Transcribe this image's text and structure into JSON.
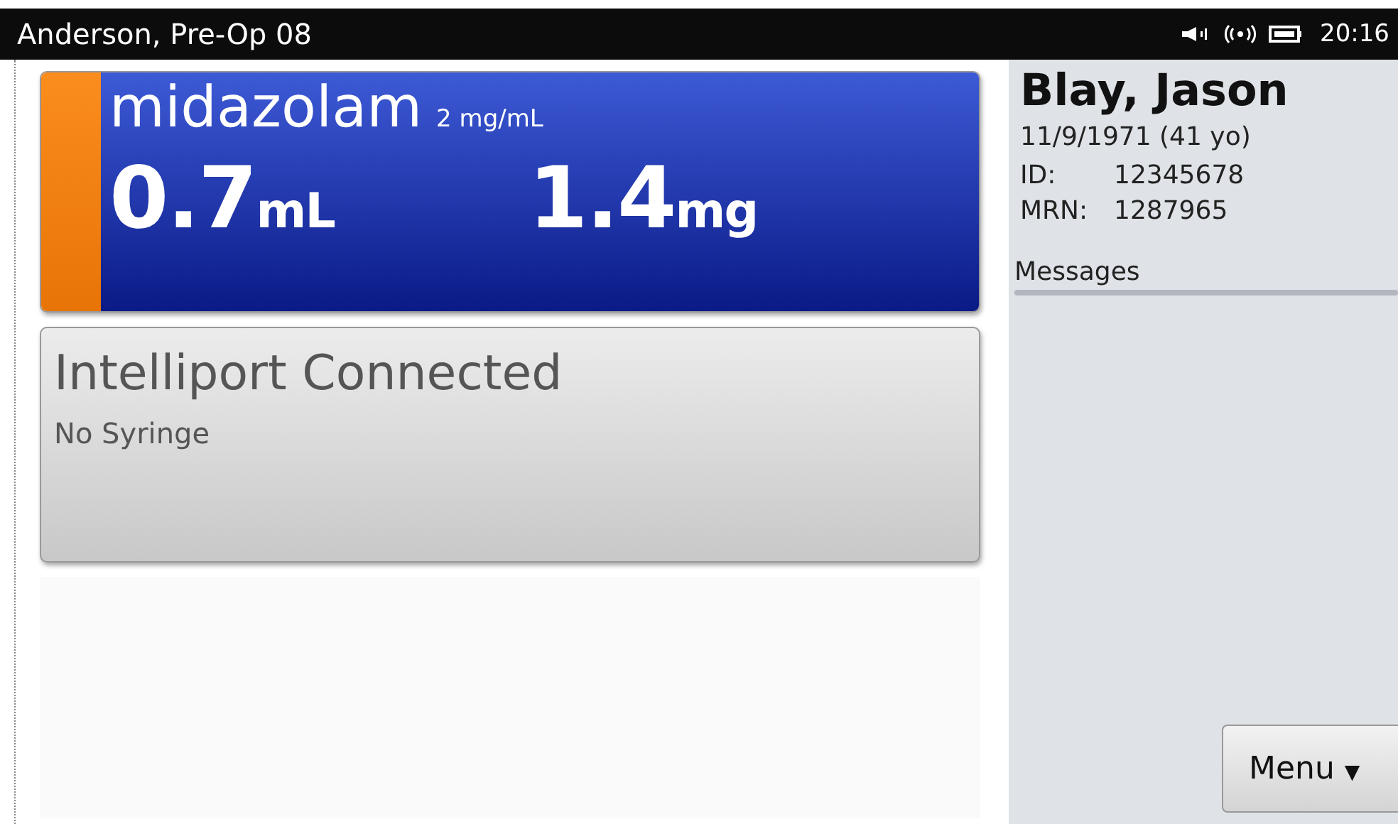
{
  "status_bar": {
    "title": "Anderson, Pre-Op 08",
    "time": "20:16"
  },
  "drug_card": {
    "name": "midazolam",
    "concentration": "2 mg/mL",
    "volume": "0.7",
    "volume_unit": "mL",
    "dose": "1.4",
    "dose_unit": "mg"
  },
  "port_card": {
    "title": "Intelliport Connected",
    "status": "No Syringe"
  },
  "patient": {
    "name": "Blay, Jason",
    "dob": "11/9/1971 (41 yo)",
    "id_label": "ID:",
    "id": "12345678",
    "mrn_label": "MRN:",
    "mrn": "1287965"
  },
  "messages": {
    "label": "Messages"
  },
  "menu_button": {
    "label": "Menu",
    "caret": "▼"
  }
}
